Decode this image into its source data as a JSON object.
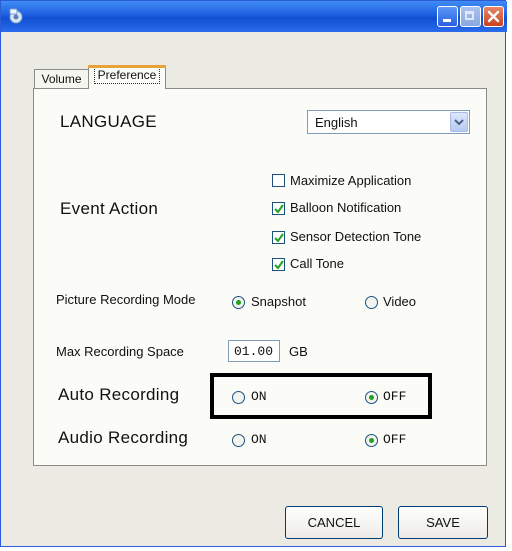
{
  "window": {
    "title": ""
  },
  "tabs": [
    {
      "label": "Volume"
    },
    {
      "label": "Preference"
    }
  ],
  "language": {
    "label": "LANGUAGE",
    "selected": "English"
  },
  "event_action": {
    "label": "Event Action",
    "options": [
      {
        "label": "Maximize Application",
        "checked": false
      },
      {
        "label": "Balloon Notification",
        "checked": true
      },
      {
        "label": "Sensor Detection Tone",
        "checked": true
      },
      {
        "label": "Call Tone",
        "checked": true
      }
    ]
  },
  "picture_recording_mode": {
    "label": "Picture Recording Mode",
    "options": [
      {
        "label": "Snapshot",
        "selected": true
      },
      {
        "label": "Video",
        "selected": false
      }
    ]
  },
  "max_recording_space": {
    "label": "Max Recording Space",
    "value": "01.00",
    "unit": "GB"
  },
  "auto_recording": {
    "label": "Auto Recording",
    "options": [
      {
        "label": "ON",
        "selected": false
      },
      {
        "label": "OFF",
        "selected": true
      }
    ]
  },
  "audio_recording": {
    "label": "Audio Recording",
    "options": [
      {
        "label": "ON",
        "selected": false
      },
      {
        "label": "OFF",
        "selected": true
      }
    ]
  },
  "buttons": {
    "cancel": "CANCEL",
    "save": "SAVE"
  },
  "colors": {
    "titlebar": "#1d5fe0",
    "highlight_border": "#000000",
    "radio_dot": "#21a121",
    "check": "#21a121"
  }
}
